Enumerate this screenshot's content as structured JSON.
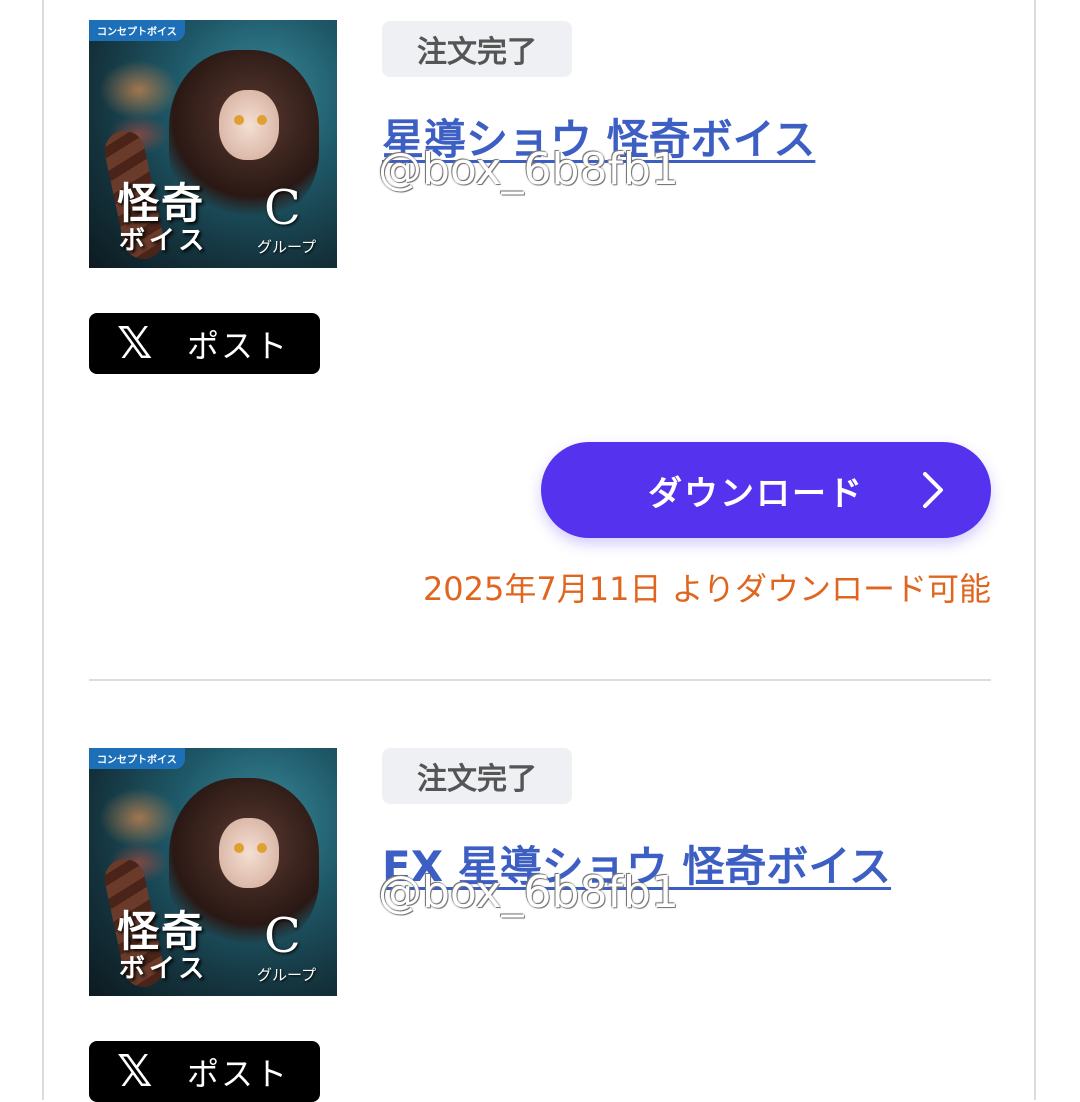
{
  "items": [
    {
      "tag": "コンセプトボイス",
      "cover_title": "怪奇",
      "cover_subtitle": "ボイス",
      "cover_group_letter": "C",
      "cover_group_label": "グループ",
      "status": "注文完了",
      "title": "星導ショウ 怪奇ボイス",
      "watermark": "@box_6b8fb1",
      "post_label": "ポスト",
      "download_label": "ダウンロード",
      "available_text": "2025年7月11日 よりダウンロード可能"
    },
    {
      "tag": "コンセプトボイス",
      "cover_title": "怪奇",
      "cover_subtitle": "ボイス",
      "cover_group_letter": "C",
      "cover_group_label": "グループ",
      "status": "注文完了",
      "title": "EX 星導ショウ 怪奇ボイス",
      "watermark": "@box_6b8fb1",
      "post_label": "ポスト"
    }
  ],
  "colors": {
    "link": "#3d5fc4",
    "download_button": "#5533ee",
    "available_text": "#e0651f",
    "status_bg": "#eef0f3"
  },
  "icons": {
    "post": "x-logo-icon",
    "download": "chevron-right-icon"
  }
}
